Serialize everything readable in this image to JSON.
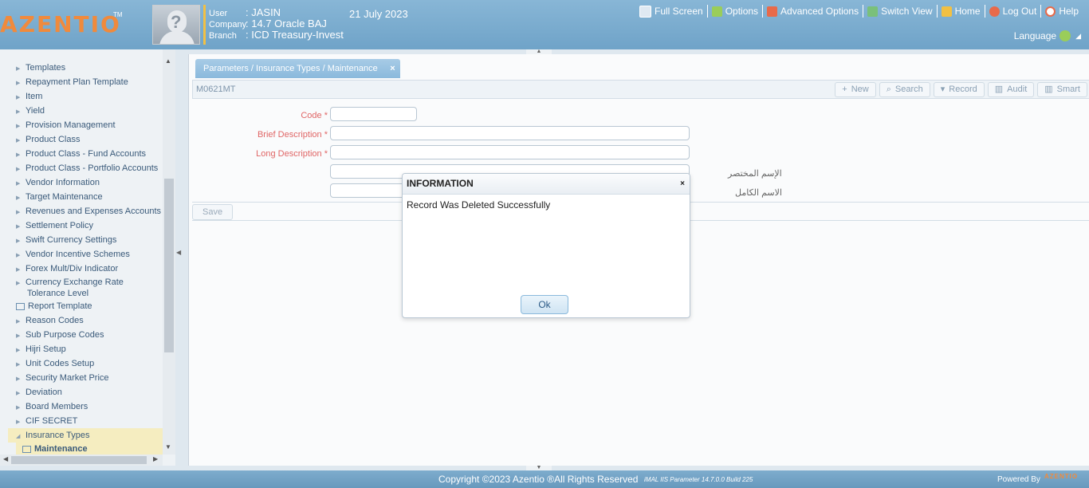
{
  "header": {
    "logo": "AZENTIO",
    "logo_tm": "TM",
    "user_label": "User",
    "user": ": JASIN",
    "company_label": "Company",
    "company": ": 14.7 Oracle BAJ",
    "branch_label": "Branch",
    "branch": ": ICD Treasury-Invest",
    "date": "21 July 2023",
    "menu": {
      "full_screen": "Full Screen",
      "options": "Options",
      "advanced_options": "Advanced Options",
      "switch_view": "Switch View",
      "home": "Home",
      "log_out": "Log Out",
      "help": "Help"
    },
    "language": "Language"
  },
  "sidebar": {
    "items": [
      "Templates",
      "Repayment Plan Template",
      "Item",
      "Yield",
      "Provision Management",
      "Product Class",
      "Product Class - Fund Accounts",
      "Product Class - Portfolio Accounts",
      "Vendor Information",
      "Target Maintenance",
      "Revenues and Expenses Accounts",
      "Settlement Policy",
      "Swift Currency Settings",
      "Vendor Incentive Schemes",
      "Forex Mult/Div Indicator",
      "Currency Exchange Rate Tolerance Level",
      "Report Template",
      "Reason Codes",
      "Sub Purpose Codes",
      "Hijri Setup",
      "Unit Codes Setup",
      "Security Market Price",
      "Deviation",
      "Board Members",
      "CIF SECRET",
      "Insurance Types",
      "Maintenance"
    ]
  },
  "tab": {
    "label": "Parameters / Insurance Types / Maintenance",
    "close": "×"
  },
  "toolbar": {
    "screen_id": "M0621MT",
    "new": "New",
    "search": "Search",
    "record": "Record",
    "audit": "Audit",
    "smart": "Smart"
  },
  "form": {
    "code_label": "Code *",
    "brief_label": "Brief Description *",
    "long_label": "Long Description *",
    "arabic_brief_label": "الإسم المختصر",
    "arabic_long_label": "الاسم الكامل",
    "save": "Save"
  },
  "dialog": {
    "title": "INFORMATION",
    "close": "×",
    "message": "Record Was Deleted Successfully",
    "ok": "Ok"
  },
  "footer": {
    "copyright": "Copyright ©2023 Azentio ®All Rights Reserved",
    "build": "iMAL IIS Parameter 14.7.0.0 Build 225",
    "powered": "Powered By",
    "logo": "AZENTIO"
  },
  "colors": {
    "header": "#7aaed1",
    "logo": "#f08a3c",
    "required_label": "#e06666",
    "selected_tree": "#f5edc0",
    "tab": "#8ab9dc"
  }
}
